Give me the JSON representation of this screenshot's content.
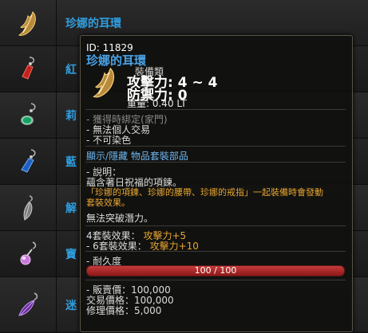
{
  "list": {
    "items": [
      {
        "name": "珍娜的耳環",
        "icon": "gold-feather-earring-icon"
      },
      {
        "name": "紅",
        "icon": "red-gem-earring-icon"
      },
      {
        "name": "莉",
        "icon": "green-gem-earring-icon"
      },
      {
        "name": "藍",
        "icon": "blue-gem-earring-icon"
      },
      {
        "name": "解",
        "icon": "gray-feather-earring-icon"
      },
      {
        "name": "寶",
        "icon": "pink-orb-earring-icon"
      },
      {
        "name": "迷",
        "icon": "purple-leaf-earring-icon"
      }
    ]
  },
  "tooltip": {
    "id_label": "ID: 11829",
    "title": "珍娜的耳環",
    "category": "裝備類",
    "attack": "攻擊力: 4 ~ 4",
    "defense": "防禦力: 0",
    "weight": "重量: 0.40 LT",
    "bind_info": "- 獲得時綁定(家門)",
    "no_trade": "- 無法個人交易",
    "no_dye": "- 不可染色",
    "set_toggle": "顯示/隱藏 物品套裝部品",
    "desc_header": "- 說明：",
    "desc_line1": "蘊含著日祝福的項鍊。",
    "desc_line2": "「珍娜的項鍊、珍娜的腰帶、珍娜的戒指」一起裝備時會發動",
    "desc_line3": "套裝效果。",
    "no_breakthrough": "無法突破潛力。",
    "set4_label": "4套裝效果：",
    "set4_value": "攻擊力+5",
    "set6_label": "- 6套裝效果：",
    "set6_value": "攻擊力+10",
    "durability_label": "- 耐久度",
    "durability_text": "100 / 100",
    "durability_fraction": 1.0,
    "sell_price": "- 販賣價：100,000",
    "trade_price": "交易價格：100,000",
    "repair_price": "修理價格：5,000"
  }
}
